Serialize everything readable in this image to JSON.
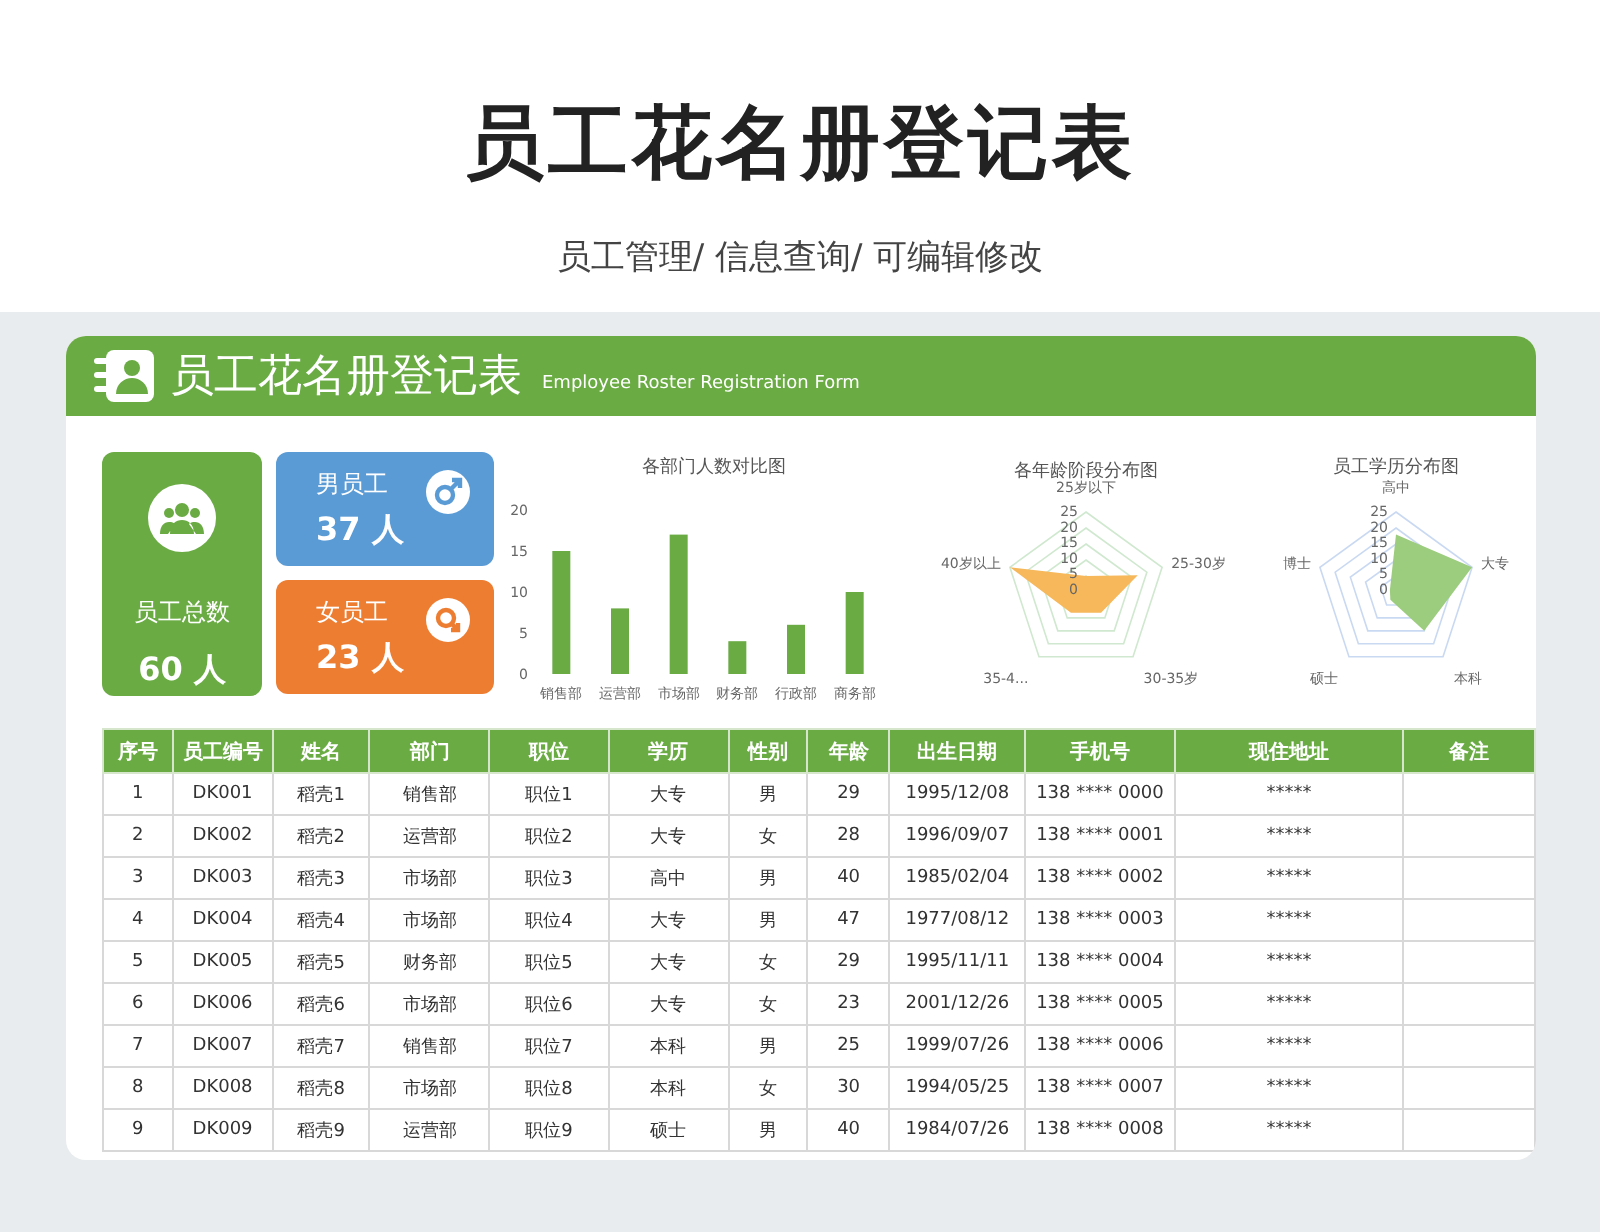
{
  "page": {
    "title": "员工花名册登记表",
    "subtitle": "员工管理/ 信息查询/ 可编辑修改"
  },
  "sheet": {
    "title": "员工花名册登记表",
    "subtitle": "Employee Roster Registration Form"
  },
  "stats": [
    {
      "kind": "total",
      "label": "员工总数",
      "value": "60 人"
    },
    {
      "kind": "male",
      "label": "男员工",
      "value": "37 人"
    },
    {
      "kind": "female",
      "label": "女员工",
      "value": "23 人"
    }
  ],
  "bar_chart": {
    "chart_data": {
      "type": "bar",
      "title": "各部门人数对比图",
      "categories": [
        "销售部",
        "运营部",
        "市场部",
        "财务部",
        "行政部",
        "商务部"
      ],
      "series": [
        {
          "color": "#6aab44",
          "values": [
            15,
            8,
            17,
            4,
            6,
            10
          ]
        }
      ],
      "ylim": [
        0,
        20
      ],
      "yticks": [
        0,
        5,
        10,
        15,
        20
      ]
    }
  },
  "radars": [
    {
      "title": "各年龄阶段分布图",
      "color": "#f6b85a",
      "axes": [
        "25岁以下",
        "25-30岁",
        "30-35岁",
        "35-4...",
        "40岁以上"
      ],
      "ticks": [
        "25",
        "20",
        "15",
        "10",
        "5",
        "0"
      ]
    },
    {
      "title": "员工学历分布图",
      "color": "#9ccc7e",
      "axes": [
        "高中",
        "大专",
        "本科",
        "硕士",
        "博士"
      ],
      "ticks": [
        "25",
        "20",
        "15",
        "10",
        "5",
        "0"
      ]
    }
  ],
  "table": {
    "columns": [
      "序号",
      "员工编号",
      "姓名",
      "部门",
      "职位",
      "学历",
      "性别",
      "年龄",
      "出生日期",
      "手机号",
      "现住地址",
      "备注"
    ],
    "rows": [
      [
        "1",
        "DK001",
        "稻壳1",
        "销售部",
        "职位1",
        "大专",
        "男",
        "29",
        "1995/12/08",
        "138 **** 0000",
        "*****"
      ],
      [
        "2",
        "DK002",
        "稻壳2",
        "运营部",
        "职位2",
        "大专",
        "女",
        "28",
        "1996/09/07",
        "138 **** 0001",
        "*****"
      ],
      [
        "3",
        "DK003",
        "稻壳3",
        "市场部",
        "职位3",
        "高中",
        "男",
        "40",
        "1985/02/04",
        "138 **** 0002",
        "*****"
      ],
      [
        "4",
        "DK004",
        "稻壳4",
        "市场部",
        "职位4",
        "大专",
        "男",
        "47",
        "1977/08/12",
        "138 **** 0003",
        "*****"
      ],
      [
        "5",
        "DK005",
        "稻壳5",
        "财务部",
        "职位5",
        "大专",
        "女",
        "29",
        "1995/11/11",
        "138 **** 0004",
        "*****"
      ],
      [
        "6",
        "DK006",
        "稻壳6",
        "市场部",
        "职位6",
        "大专",
        "女",
        "23",
        "2001/12/26",
        "138 **** 0005",
        "*****"
      ],
      [
        "7",
        "DK007",
        "稻壳7",
        "销售部",
        "职位7",
        "本科",
        "男",
        "25",
        "1999/07/26",
        "138 **** 0006",
        "*****"
      ],
      [
        "8",
        "DK008",
        "稻壳8",
        "市场部",
        "职位8",
        "本科",
        "女",
        "30",
        "1994/05/25",
        "138 **** 0007",
        "*****"
      ],
      [
        "9",
        "DK009",
        "稻壳9",
        "运营部",
        "职位9",
        "硕士",
        "男",
        "40",
        "1984/07/26",
        "138 **** 0008",
        "*****"
      ]
    ]
  }
}
